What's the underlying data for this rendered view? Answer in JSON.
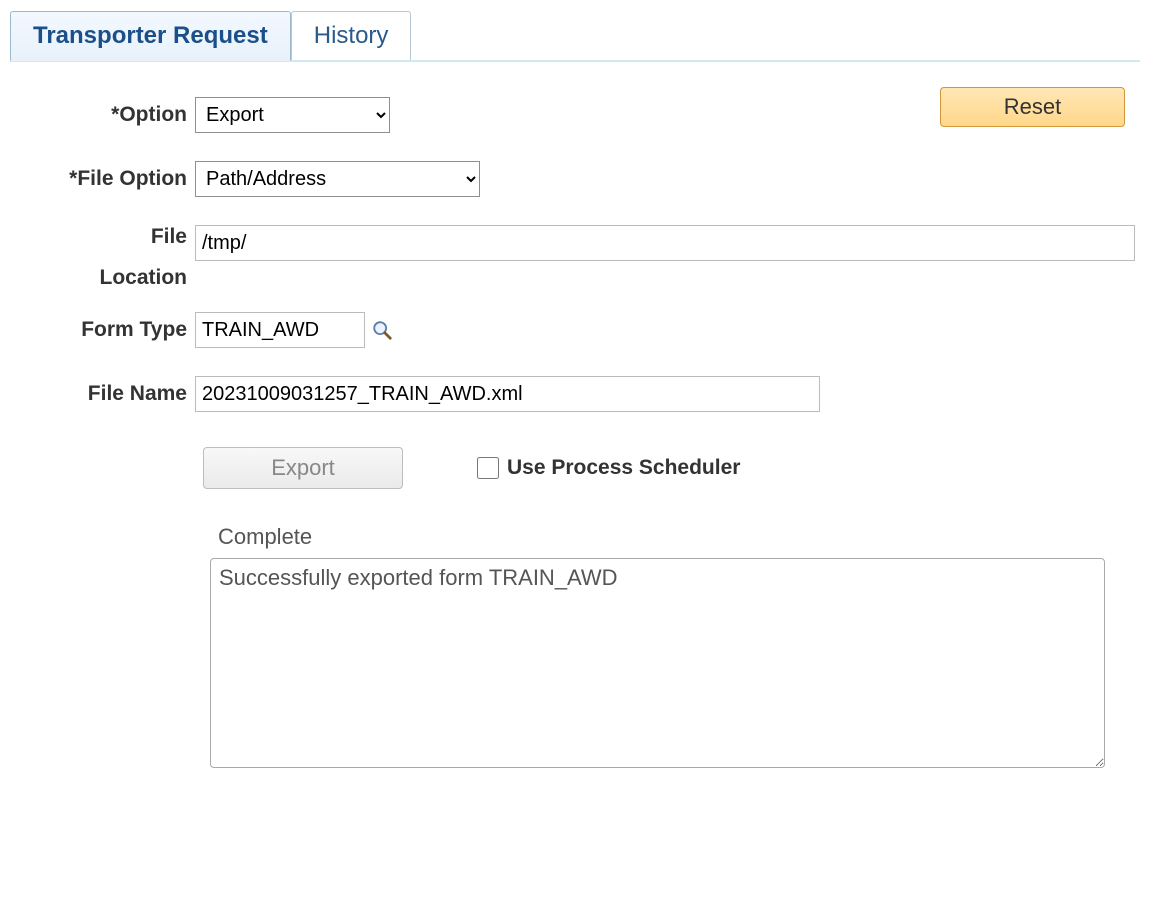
{
  "tabs": {
    "transporter_request": "Transporter Request",
    "history": "History"
  },
  "buttons": {
    "reset": "Reset",
    "export": "Export"
  },
  "labels": {
    "option": "*Option",
    "file_option": "*File Option",
    "file": "File",
    "location": "Location",
    "form_type": "Form Type",
    "file_name": "File Name",
    "use_process_scheduler": "Use Process Scheduler"
  },
  "fields": {
    "option_value": "Export",
    "file_option_value": "Path/Address",
    "file_value": "/tmp/",
    "form_type_value": "TRAIN_AWD",
    "file_name_value": "20231009031257_TRAIN_AWD.xml",
    "use_process_scheduler_checked": false
  },
  "status": {
    "heading": "Complete",
    "message": "Successfully exported form TRAIN_AWD"
  }
}
